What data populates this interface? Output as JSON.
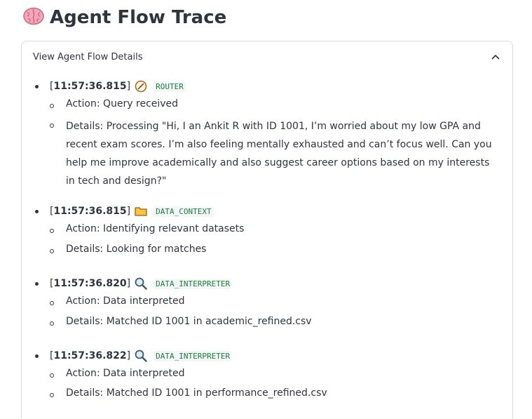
{
  "page": {
    "title": "Agent Flow Trace",
    "title_icon": "brain-icon"
  },
  "expander": {
    "label": "View Agent Flow Details",
    "state": "expanded",
    "chevron_icon": "chevron-up-icon"
  },
  "entries": [
    {
      "timestamp": "11:57:36.815",
      "icon": "compass-icon",
      "agent": "ROUTER",
      "action_label": "Action: Query received",
      "details_label": "Details: Processing \"Hi, I an Ankit R with ID 1001, I’m worried about my low GPA and recent exam scores. I’m also feeling mentally exhausted and can’t focus well. Can you help me improve academically and also suggest career options based on my interests in tech and design?\""
    },
    {
      "timestamp": "11:57:36.815",
      "icon": "folder-icon",
      "agent": "DATA_CONTEXT",
      "action_label": "Action: Identifying relevant datasets",
      "details_label": "Details: Looking for matches"
    },
    {
      "timestamp": "11:57:36.820",
      "icon": "magnifier-icon",
      "agent": "DATA_INTERPRETER",
      "action_label": "Action: Data interpreted",
      "details_label": "Details: Matched ID 1001 in academic_refined.csv"
    },
    {
      "timestamp": "11:57:36.822",
      "icon": "magnifier-icon",
      "agent": "DATA_INTERPRETER",
      "action_label": "Action: Data interpreted",
      "details_label": "Details: Matched ID 1001 in performance_refined.csv"
    }
  ],
  "colors": {
    "text": "#31333f",
    "agent_code": "#1a7f3c",
    "border": "#d9dbe2"
  }
}
